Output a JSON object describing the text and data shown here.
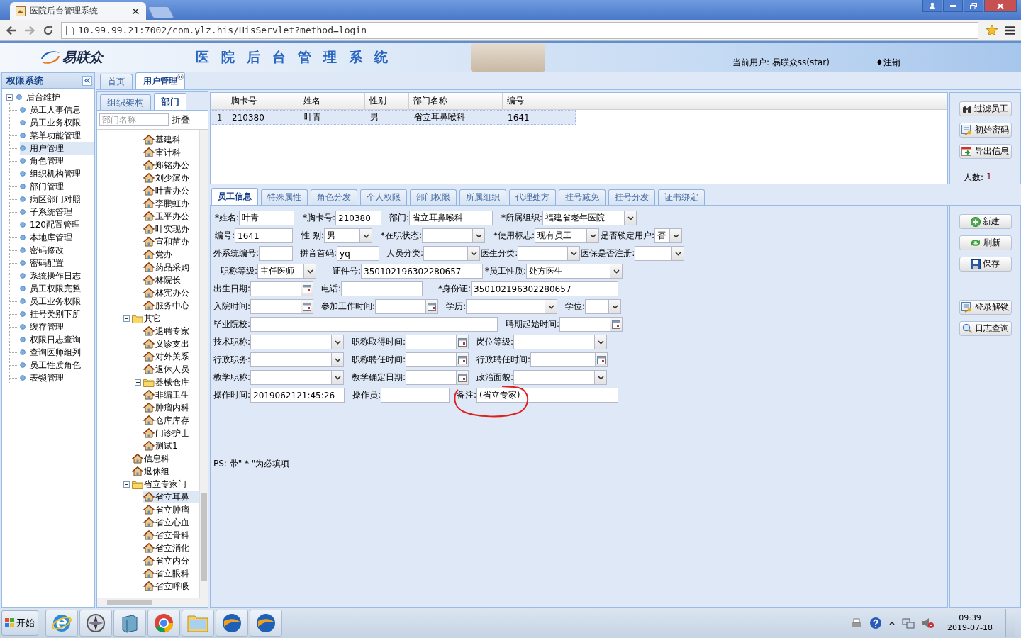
{
  "browser": {
    "tab_title": "医院后台管理系统",
    "tab_close": "×",
    "url": "10.99.99.21:7002/com.ylz.his/HisServlet?method=login"
  },
  "header": {
    "logo": "易联众",
    "title": "医院后台管理系统",
    "current_user": "当前用户: 易联众ss(star)",
    "logout": "♦注销"
  },
  "sidebar": {
    "title": "权限系统",
    "tree": {
      "label": "后台维护",
      "expanded": true,
      "children": [
        {
          "label": "员工人事信息",
          "selected": false
        },
        {
          "label": "员工业务权限",
          "selected": false
        },
        {
          "label": "菜单功能管理",
          "selected": false
        },
        {
          "label": "用户管理",
          "selected": true
        },
        {
          "label": "角色管理",
          "selected": false
        },
        {
          "label": "组织机构管理",
          "selected": false
        },
        {
          "label": "部门管理",
          "selected": false
        },
        {
          "label": "病区部门对照",
          "selected": false
        },
        {
          "label": "子系统管理",
          "selected": false
        },
        {
          "label": "120配置管理",
          "selected": false
        },
        {
          "label": "本地库管理",
          "selected": false
        },
        {
          "label": "密码修改",
          "selected": false
        },
        {
          "label": "密码配置",
          "selected": false
        },
        {
          "label": "系统操作日志",
          "selected": false
        },
        {
          "label": "员工权限完整",
          "selected": false
        },
        {
          "label": "员工业务权限",
          "selected": false
        },
        {
          "label": "挂号类别下所",
          "selected": false
        },
        {
          "label": "缓存管理",
          "selected": false
        },
        {
          "label": "权限日志查询",
          "selected": false
        },
        {
          "label": "查询医师组列",
          "selected": false
        },
        {
          "label": "员工性质角色",
          "selected": false
        },
        {
          "label": "表锁管理",
          "selected": false
        }
      ]
    }
  },
  "main_tabs": [
    {
      "label": "首页",
      "selected": false,
      "closable": false
    },
    {
      "label": "用户管理",
      "selected": true,
      "closable": true
    }
  ],
  "dept_panel": {
    "tabs": [
      {
        "label": "组织架构",
        "selected": false
      },
      {
        "label": "部门",
        "selected": true
      }
    ],
    "search": {
      "placeholder": "部门名称"
    },
    "collapse_button": "折叠",
    "continued_items": [
      {
        "kind": "dept",
        "label": "基建科",
        "selected": false
      },
      {
        "kind": "dept",
        "label": "审计科",
        "selected": false
      },
      {
        "kind": "dept",
        "label": "郑铭办公",
        "selected": false
      },
      {
        "kind": "dept",
        "label": "刘少滨办",
        "selected": false
      },
      {
        "kind": "dept",
        "label": "叶青办公",
        "selected": false
      },
      {
        "kind": "dept",
        "label": "李鹏虹办",
        "selected": false
      },
      {
        "kind": "dept",
        "label": "卫平办公",
        "selected": false
      },
      {
        "kind": "dept",
        "label": "叶实现办",
        "selected": false
      },
      {
        "kind": "dept",
        "label": "宣和苗办",
        "selected": false
      },
      {
        "kind": "dept",
        "label": "党办",
        "selected": false
      },
      {
        "kind": "dept",
        "label": "药品采购",
        "selected": false
      },
      {
        "kind": "dept",
        "label": "林院长",
        "selected": false
      },
      {
        "kind": "dept",
        "label": "林宪办公",
        "selected": false
      },
      {
        "kind": "dept",
        "label": "服务中心",
        "selected": false
      }
    ],
    "nodes": [
      {
        "kind": "folder",
        "label": "其它",
        "expanded": true,
        "selected": false,
        "children": [
          {
            "kind": "dept",
            "label": "退聘专家",
            "selected": false
          },
          {
            "kind": "dept",
            "label": "义诊支出",
            "selected": false
          },
          {
            "kind": "dept",
            "label": "对外关系",
            "selected": false
          },
          {
            "kind": "dept",
            "label": "退休人员",
            "selected": false
          },
          {
            "kind": "folder",
            "label": "器械仓库",
            "expanded": false,
            "selected": false
          },
          {
            "kind": "dept",
            "label": "非编卫生",
            "selected": false
          },
          {
            "kind": "dept",
            "label": "肿瘤内科",
            "selected": false
          },
          {
            "kind": "dept",
            "label": "仓库库存",
            "selected": false
          },
          {
            "kind": "dept",
            "label": "门诊护士",
            "selected": false
          },
          {
            "kind": "dept",
            "label": "测试1",
            "selected": false
          }
        ]
      },
      {
        "kind": "dept",
        "label": "信息科",
        "selected": false
      },
      {
        "kind": "dept",
        "label": "退休组",
        "selected": false
      },
      {
        "kind": "folder",
        "label": "省立专家门",
        "expanded": true,
        "selected": false,
        "children": [
          {
            "kind": "dept",
            "label": "省立耳鼻",
            "selected": true
          },
          {
            "kind": "dept",
            "label": "省立肿瘤",
            "selected": false
          },
          {
            "kind": "dept",
            "label": "省立心血",
            "selected": false
          },
          {
            "kind": "dept",
            "label": "省立骨科",
            "selected": false
          },
          {
            "kind": "dept",
            "label": "省立消化",
            "selected": false
          },
          {
            "kind": "dept",
            "label": "省立内分",
            "selected": false
          },
          {
            "kind": "dept",
            "label": "省立眼科",
            "selected": false
          },
          {
            "kind": "dept",
            "label": "省立呼吸",
            "selected": false
          }
        ]
      }
    ]
  },
  "staff_grid": {
    "columns": [
      "胸卡号",
      "姓名",
      "性别",
      "部门名称",
      "编号"
    ],
    "rows": [
      {
        "number": "1",
        "selected": true,
        "cells": [
          "210380",
          "叶青",
          "男",
          "省立耳鼻喉科",
          "1641"
        ]
      }
    ]
  },
  "grid_actions": {
    "buttons": [
      {
        "kind": "filter",
        "label": "过滤员工"
      },
      {
        "kind": "password",
        "label": "初始密码"
      },
      {
        "kind": "export",
        "label": "导出信息"
      }
    ],
    "count_label": "人数:",
    "count": "1"
  },
  "detail_tabs": [
    {
      "label": "员工信息",
      "selected": true
    },
    {
      "label": "特殊属性",
      "selected": false
    },
    {
      "label": "角色分发",
      "selected": false
    },
    {
      "label": "个人权限",
      "selected": false
    },
    {
      "label": "部门权限",
      "selected": false
    },
    {
      "label": "所属组织",
      "selected": false
    },
    {
      "label": "代理处方",
      "selected": false
    },
    {
      "label": "挂号减免",
      "selected": false
    },
    {
      "label": "挂号分发",
      "selected": false
    },
    {
      "label": "证书绑定",
      "selected": false
    }
  ],
  "form": {
    "rows": [
      [
        {
          "label": "*姓名:",
          "kind": "text",
          "value": "叶青"
        },
        {
          "label": "*胸卡号:",
          "kind": "text",
          "value": "210380"
        },
        {
          "label": "部门:",
          "kind": "text",
          "value": "省立耳鼻喉科"
        },
        {
          "label": "*所属组织:",
          "kind": "select",
          "value": "福建省老年医院"
        }
      ],
      [
        {
          "label": "编号:",
          "kind": "text",
          "value": "1641"
        },
        {
          "label": "性 别:",
          "kind": "select",
          "value": "男"
        },
        {
          "label": "*在职状态:",
          "kind": "select"
        },
        {
          "label": "*使用标志:",
          "kind": "select",
          "value": "现有员工"
        },
        {
          "label": "是否锁定用户:",
          "kind": "select",
          "value": "否"
        }
      ],
      [
        {
          "label": "外系统编号:",
          "kind": "text"
        },
        {
          "label": "拼音首码:",
          "kind": "text",
          "value": "yq"
        },
        {
          "label": "人员分类:",
          "kind": "select"
        },
        {
          "label": "医生分类:",
          "kind": "select"
        },
        {
          "label": "医保是否注册:",
          "kind": "select"
        }
      ],
      [
        {
          "label": "职称等级:",
          "kind": "select",
          "value": "主任医师"
        },
        {
          "label": "证件号:",
          "kind": "text",
          "value": "350102196302280657"
        },
        {
          "label": "*员工性质:",
          "kind": "select",
          "value": "处方医生"
        }
      ],
      [
        {
          "label": "出生日期:",
          "kind": "date"
        },
        {
          "label": "电话:",
          "kind": "text"
        },
        {
          "label": "*身份证:",
          "kind": "text",
          "value": "350102196302280657"
        }
      ],
      [
        {
          "label": "入院时间:",
          "kind": "date"
        },
        {
          "label": "参加工作时间:",
          "kind": "date"
        },
        {
          "label": "学历:",
          "kind": "select"
        },
        {
          "label": "学位:",
          "kind": "select"
        }
      ],
      [
        {
          "label": "毕业院校:",
          "kind": "text"
        },
        {
          "label": "聘期起始时间:",
          "kind": "date"
        }
      ],
      [
        {
          "label": "技术职称:",
          "kind": "select"
        },
        {
          "label": "职称取得时间:",
          "kind": "date"
        },
        {
          "label": "岗位等级:",
          "kind": "select"
        }
      ],
      [
        {
          "label": "行政职务:",
          "kind": "select"
        },
        {
          "label": "职称聘任时间:",
          "kind": "date"
        },
        {
          "label": "行政聘任时间:",
          "kind": "date"
        }
      ],
      [
        {
          "label": "教学职称:",
          "kind": "select"
        },
        {
          "label": "教学确定日期:",
          "kind": "date"
        },
        {
          "label": "政治面貌:",
          "kind": "select"
        }
      ],
      [
        {
          "label": "操作时间:",
          "kind": "text",
          "value": "2019062121:45:26"
        },
        {
          "label": "操作员:",
          "kind": "text"
        },
        {
          "label": "备注:",
          "kind": "text",
          "value": "(省立专家)"
        }
      ]
    ],
    "note": "PS: 带\" * \"为必填项"
  },
  "form_actions": [
    {
      "kind": "new",
      "label": "新建"
    },
    {
      "kind": "refresh",
      "label": "刷新"
    },
    {
      "kind": "save",
      "label": "保存"
    },
    {
      "kind": "unlock",
      "label": "登录解锁"
    },
    {
      "kind": "log",
      "label": "日志查询"
    }
  ],
  "taskbar": {
    "start": "开始",
    "time": "09:39",
    "date": "2019-07-18"
  }
}
